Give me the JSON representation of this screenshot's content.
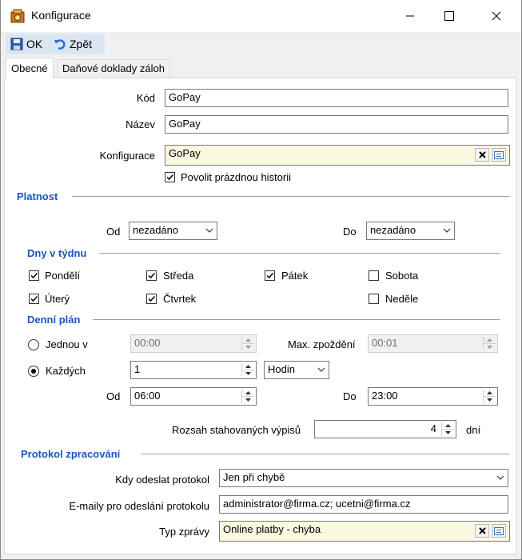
{
  "window": {
    "title": "Konfigurace"
  },
  "toolbar": {
    "ok_label": "OK",
    "back_label": "Zpět"
  },
  "tabs": [
    {
      "label": "Obecné",
      "active": true
    },
    {
      "label": "Daňové doklady záloh",
      "active": false
    }
  ],
  "general": {
    "kod_label": "Kód",
    "kod_value": "GoPay",
    "nazev_label": "Název",
    "nazev_value": "GoPay",
    "konfigurace_label": "Konfigurace",
    "konfigurace_value": "GoPay",
    "povolit_label": "Povolit prázdnou historii",
    "povolit_checked": true
  },
  "platnost": {
    "section_title": "Platnost",
    "od_label": "Od",
    "od_value": "nezadáno",
    "do_label": "Do",
    "do_value": "nezadáno"
  },
  "dny": {
    "section_title": "Dny v týdnu",
    "days": [
      {
        "label": "Pondělí",
        "checked": true
      },
      {
        "label": "Středa",
        "checked": true
      },
      {
        "label": "Pátek",
        "checked": true
      },
      {
        "label": "Sobota",
        "checked": false
      },
      {
        "label": "Úterý",
        "checked": true
      },
      {
        "label": "Čtvrtek",
        "checked": true
      },
      {
        "label": "Neděle",
        "checked": false
      }
    ]
  },
  "plan": {
    "section_title": "Denní plán",
    "jednou_label": "Jednou v",
    "jednou_value": "00:00",
    "jednou_selected": false,
    "max_label": "Max. zpoždění",
    "max_value": "00:01",
    "kazdych_label": "Každých",
    "kazdych_value": "1",
    "kazdych_selected": true,
    "unit_value": "Hodin",
    "od_label": "Od",
    "od_value": "06:00",
    "do_label": "Do",
    "do_value": "23:00",
    "rozsah_label": "Rozsah stahovaných výpisů",
    "rozsah_value": "4",
    "rozsah_unit": "dní"
  },
  "protokol": {
    "section_title": "Protokol zpracování",
    "kdy_label": "Kdy odeslat protokol",
    "kdy_value": "Jen při chybě",
    "emaily_label": "E-maily pro odeslání protokolu",
    "emaily_value": "administrator@firma.cz; ucetni@firma.cz",
    "typ_label": "Typ zprávy",
    "typ_value": "Online platby - chyba"
  },
  "colors": {
    "section": "#1a56c4",
    "lookup_bg": "#fbf8e0",
    "toolbar_bg": "#dbe6f4"
  }
}
